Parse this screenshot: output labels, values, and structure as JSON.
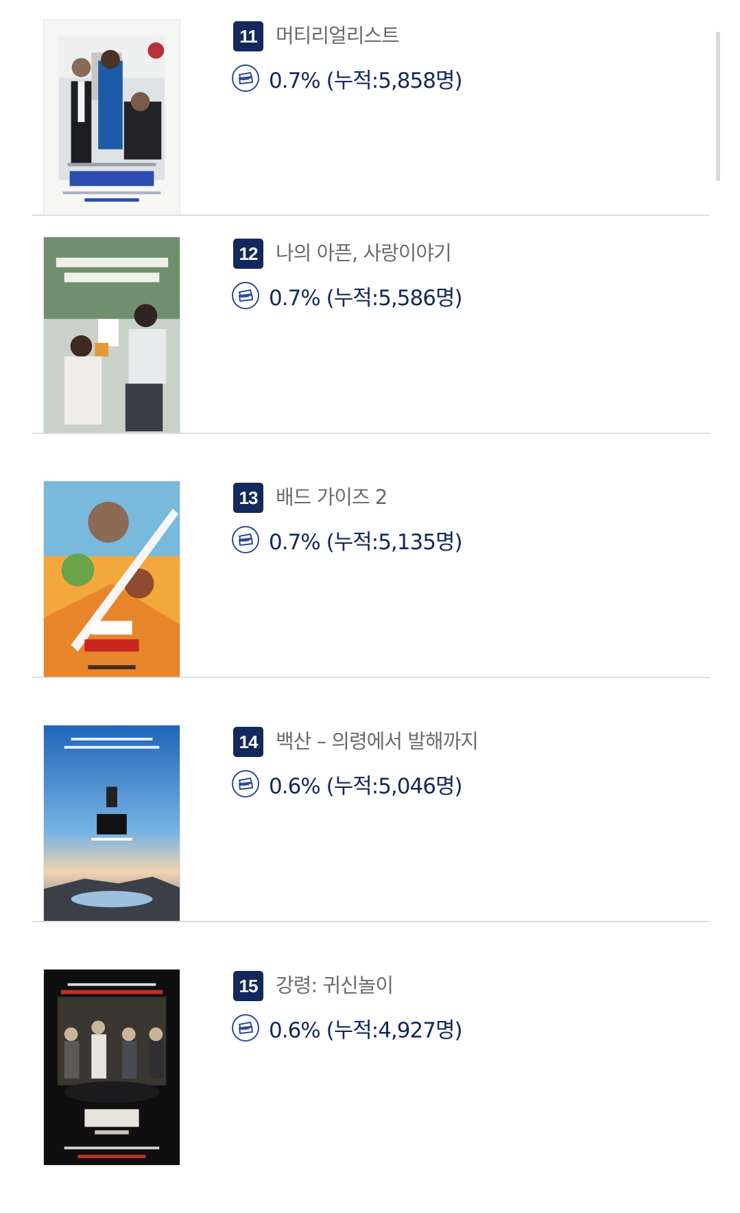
{
  "movies": [
    {
      "rank": "11",
      "title": "머티리얼리스트",
      "share": "0.7%",
      "cumulative": "(누적:5,858명)",
      "poster": "poster-materialists"
    },
    {
      "rank": "12",
      "title": "나의 아픈, 사랑이야기",
      "share": "0.7%",
      "cumulative": "(누적:5,586명)",
      "poster": "poster-love-story"
    },
    {
      "rank": "13",
      "title": "배드 가이즈 2",
      "share": "0.7%",
      "cumulative": "(누적:5,135명)",
      "poster": "poster-bad-guys-2"
    },
    {
      "rank": "14",
      "title": "백산 – 의령에서 발해까지",
      "share": "0.6%",
      "cumulative": "(누적:5,046명)",
      "poster": "poster-baeksan"
    },
    {
      "rank": "15",
      "title": "강령: 귀신놀이",
      "share": "0.6%",
      "cumulative": "(누적:4,927명)",
      "poster": "poster-ghost-game"
    }
  ],
  "icons": {
    "ticket": "ticket-icon"
  },
  "colors": {
    "rank_badge": "#13285c",
    "stat_text": "#13285c",
    "title_text": "#6b6b6b",
    "divider": "#dedede"
  }
}
